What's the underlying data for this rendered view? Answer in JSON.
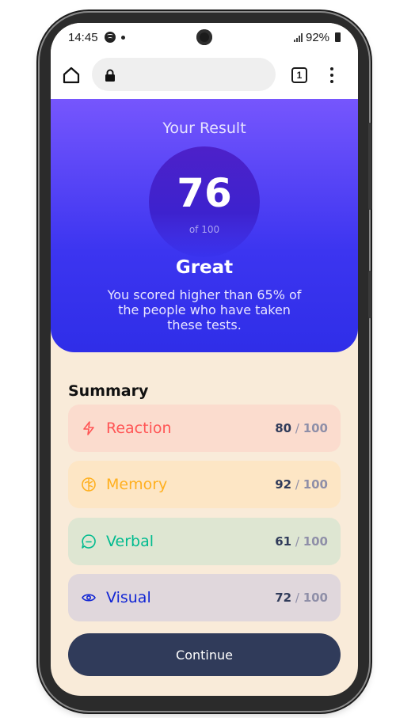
{
  "status_bar": {
    "time": "14:45",
    "battery": "92%"
  },
  "browser": {
    "url": "",
    "tab_count": "1"
  },
  "result": {
    "title": "Your Result",
    "score": "76",
    "score_total": "of 100",
    "rating": "Great",
    "description": "You scored higher than 65% of the people who have taken these tests."
  },
  "summary": {
    "title": "Summary",
    "items": [
      {
        "label": "Reaction",
        "score": "80",
        "separator": " / ",
        "max": "100",
        "icon": "lightning-icon",
        "color": "#f55",
        "bg": "#fbdcce"
      },
      {
        "label": "Memory",
        "score": "92",
        "separator": " / ",
        "max": "100",
        "icon": "brain-icon",
        "color": "#ffb01f",
        "bg": "#fde6c5"
      },
      {
        "label": "Verbal",
        "score": "61",
        "separator": " / ",
        "max": "100",
        "icon": "chat-icon",
        "color": "#00bb8f",
        "bg": "#dee6d2"
      },
      {
        "label": "Visual",
        "score": "72",
        "separator": " / ",
        "max": "100",
        "icon": "eye-icon",
        "color": "#1125d4",
        "bg": "#e0d7dc"
      }
    ]
  },
  "continue_label": "Continue"
}
